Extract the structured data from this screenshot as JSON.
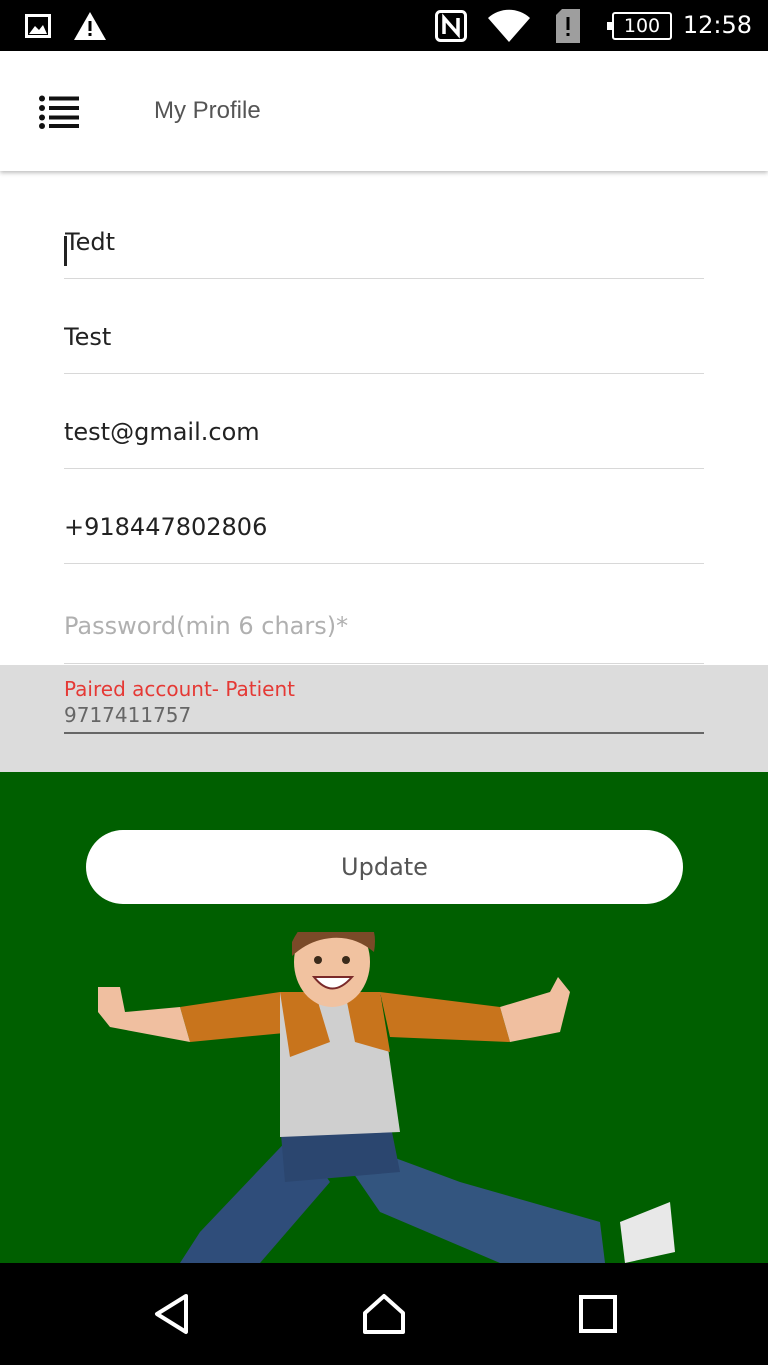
{
  "status_bar": {
    "time": "12:58",
    "battery_level": "100",
    "icons": [
      "image-icon",
      "warning-icon",
      "nfc-icon",
      "wifi-icon",
      "sim-icon",
      "battery-icon"
    ]
  },
  "app_bar": {
    "title": "My Profile",
    "menu_icon": "menu-list-icon"
  },
  "form": {
    "first_name": "Tedt",
    "last_name": "Test",
    "email": "test@gmail.com",
    "phone": "+918447802806",
    "password_value": "",
    "password_placeholder": "Password(min 6 chars)*"
  },
  "paired_account": {
    "label": "Paired account- Patient",
    "value": "9717411757"
  },
  "update_button": {
    "label": "Update"
  },
  "colors": {
    "accent_green": "#005f00",
    "error_red": "#e53935",
    "panel_gray": "#dcdcdc"
  },
  "nav_bar": {
    "buttons": [
      "back-icon",
      "home-icon",
      "recents-icon"
    ]
  }
}
